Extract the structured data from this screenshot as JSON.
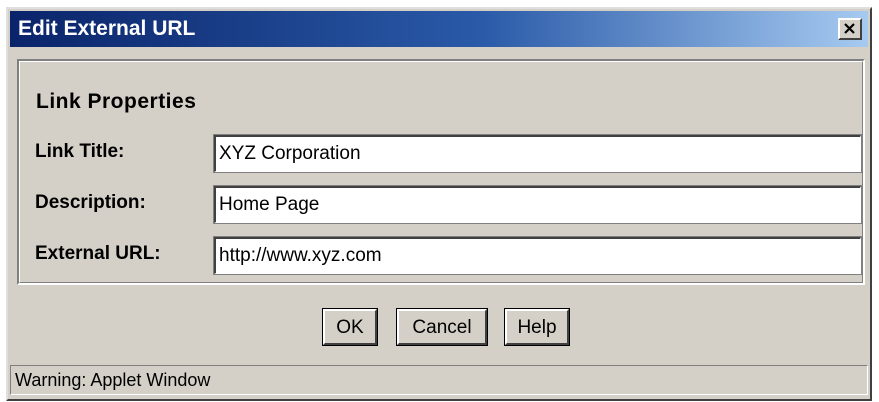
{
  "window": {
    "title": "Edit External URL",
    "close_icon": "close-icon"
  },
  "panel": {
    "heading": "Link Properties",
    "fields": [
      {
        "label": "Link Title:",
        "value": "XYZ Corporation"
      },
      {
        "label": "Description:",
        "value": "Home Page"
      },
      {
        "label": "External URL:",
        "value": "http://www.xyz.com"
      }
    ]
  },
  "buttons": {
    "ok": "OK",
    "cancel": "Cancel",
    "help": "Help"
  },
  "status": {
    "text": "Warning: Applet Window"
  },
  "colors": {
    "title_gradient_start": "#0a246a",
    "title_gradient_end": "#a6caf0",
    "face": "#d4d0c8"
  }
}
